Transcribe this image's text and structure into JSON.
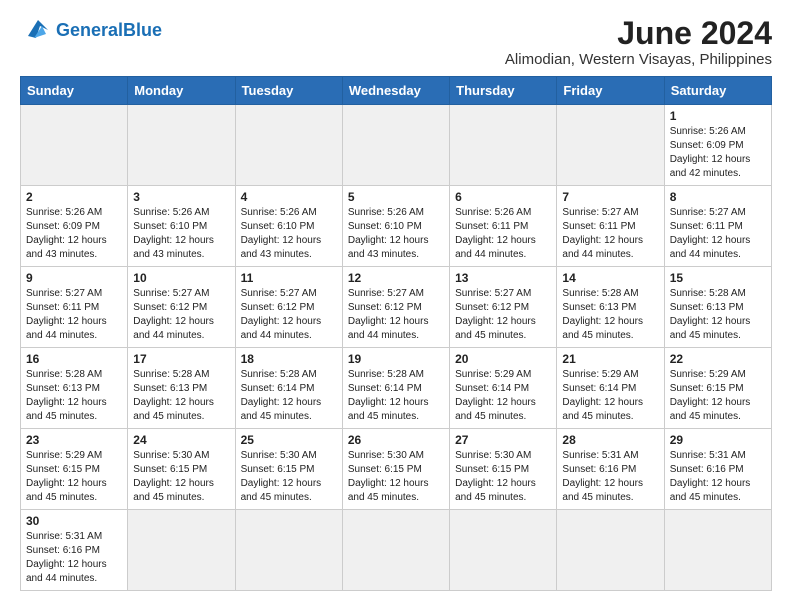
{
  "header": {
    "logo_general": "General",
    "logo_blue": "Blue",
    "month_title": "June 2024",
    "location": "Alimodian, Western Visayas, Philippines"
  },
  "weekdays": [
    "Sunday",
    "Monday",
    "Tuesday",
    "Wednesday",
    "Thursday",
    "Friday",
    "Saturday"
  ],
  "days": [
    {
      "date": "",
      "info": ""
    },
    {
      "date": "",
      "info": ""
    },
    {
      "date": "",
      "info": ""
    },
    {
      "date": "",
      "info": ""
    },
    {
      "date": "",
      "info": ""
    },
    {
      "date": "",
      "info": ""
    },
    {
      "date": "1",
      "info": "Sunrise: 5:26 AM\nSunset: 6:09 PM\nDaylight: 12 hours\nand 42 minutes."
    },
    {
      "date": "2",
      "info": "Sunrise: 5:26 AM\nSunset: 6:09 PM\nDaylight: 12 hours\nand 43 minutes."
    },
    {
      "date": "3",
      "info": "Sunrise: 5:26 AM\nSunset: 6:10 PM\nDaylight: 12 hours\nand 43 minutes."
    },
    {
      "date": "4",
      "info": "Sunrise: 5:26 AM\nSunset: 6:10 PM\nDaylight: 12 hours\nand 43 minutes."
    },
    {
      "date": "5",
      "info": "Sunrise: 5:26 AM\nSunset: 6:10 PM\nDaylight: 12 hours\nand 43 minutes."
    },
    {
      "date": "6",
      "info": "Sunrise: 5:26 AM\nSunset: 6:11 PM\nDaylight: 12 hours\nand 44 minutes."
    },
    {
      "date": "7",
      "info": "Sunrise: 5:27 AM\nSunset: 6:11 PM\nDaylight: 12 hours\nand 44 minutes."
    },
    {
      "date": "8",
      "info": "Sunrise: 5:27 AM\nSunset: 6:11 PM\nDaylight: 12 hours\nand 44 minutes."
    },
    {
      "date": "9",
      "info": "Sunrise: 5:27 AM\nSunset: 6:11 PM\nDaylight: 12 hours\nand 44 minutes."
    },
    {
      "date": "10",
      "info": "Sunrise: 5:27 AM\nSunset: 6:12 PM\nDaylight: 12 hours\nand 44 minutes."
    },
    {
      "date": "11",
      "info": "Sunrise: 5:27 AM\nSunset: 6:12 PM\nDaylight: 12 hours\nand 44 minutes."
    },
    {
      "date": "12",
      "info": "Sunrise: 5:27 AM\nSunset: 6:12 PM\nDaylight: 12 hours\nand 44 minutes."
    },
    {
      "date": "13",
      "info": "Sunrise: 5:27 AM\nSunset: 6:12 PM\nDaylight: 12 hours\nand 45 minutes."
    },
    {
      "date": "14",
      "info": "Sunrise: 5:28 AM\nSunset: 6:13 PM\nDaylight: 12 hours\nand 45 minutes."
    },
    {
      "date": "15",
      "info": "Sunrise: 5:28 AM\nSunset: 6:13 PM\nDaylight: 12 hours\nand 45 minutes."
    },
    {
      "date": "16",
      "info": "Sunrise: 5:28 AM\nSunset: 6:13 PM\nDaylight: 12 hours\nand 45 minutes."
    },
    {
      "date": "17",
      "info": "Sunrise: 5:28 AM\nSunset: 6:13 PM\nDaylight: 12 hours\nand 45 minutes."
    },
    {
      "date": "18",
      "info": "Sunrise: 5:28 AM\nSunset: 6:14 PM\nDaylight: 12 hours\nand 45 minutes."
    },
    {
      "date": "19",
      "info": "Sunrise: 5:28 AM\nSunset: 6:14 PM\nDaylight: 12 hours\nand 45 minutes."
    },
    {
      "date": "20",
      "info": "Sunrise: 5:29 AM\nSunset: 6:14 PM\nDaylight: 12 hours\nand 45 minutes."
    },
    {
      "date": "21",
      "info": "Sunrise: 5:29 AM\nSunset: 6:14 PM\nDaylight: 12 hours\nand 45 minutes."
    },
    {
      "date": "22",
      "info": "Sunrise: 5:29 AM\nSunset: 6:15 PM\nDaylight: 12 hours\nand 45 minutes."
    },
    {
      "date": "23",
      "info": "Sunrise: 5:29 AM\nSunset: 6:15 PM\nDaylight: 12 hours\nand 45 minutes."
    },
    {
      "date": "24",
      "info": "Sunrise: 5:30 AM\nSunset: 6:15 PM\nDaylight: 12 hours\nand 45 minutes."
    },
    {
      "date": "25",
      "info": "Sunrise: 5:30 AM\nSunset: 6:15 PM\nDaylight: 12 hours\nand 45 minutes."
    },
    {
      "date": "26",
      "info": "Sunrise: 5:30 AM\nSunset: 6:15 PM\nDaylight: 12 hours\nand 45 minutes."
    },
    {
      "date": "27",
      "info": "Sunrise: 5:30 AM\nSunset: 6:15 PM\nDaylight: 12 hours\nand 45 minutes."
    },
    {
      "date": "28",
      "info": "Sunrise: 5:31 AM\nSunset: 6:16 PM\nDaylight: 12 hours\nand 45 minutes."
    },
    {
      "date": "29",
      "info": "Sunrise: 5:31 AM\nSunset: 6:16 PM\nDaylight: 12 hours\nand 45 minutes."
    },
    {
      "date": "30",
      "info": "Sunrise: 5:31 AM\nSunset: 6:16 PM\nDaylight: 12 hours\nand 44 minutes."
    }
  ]
}
